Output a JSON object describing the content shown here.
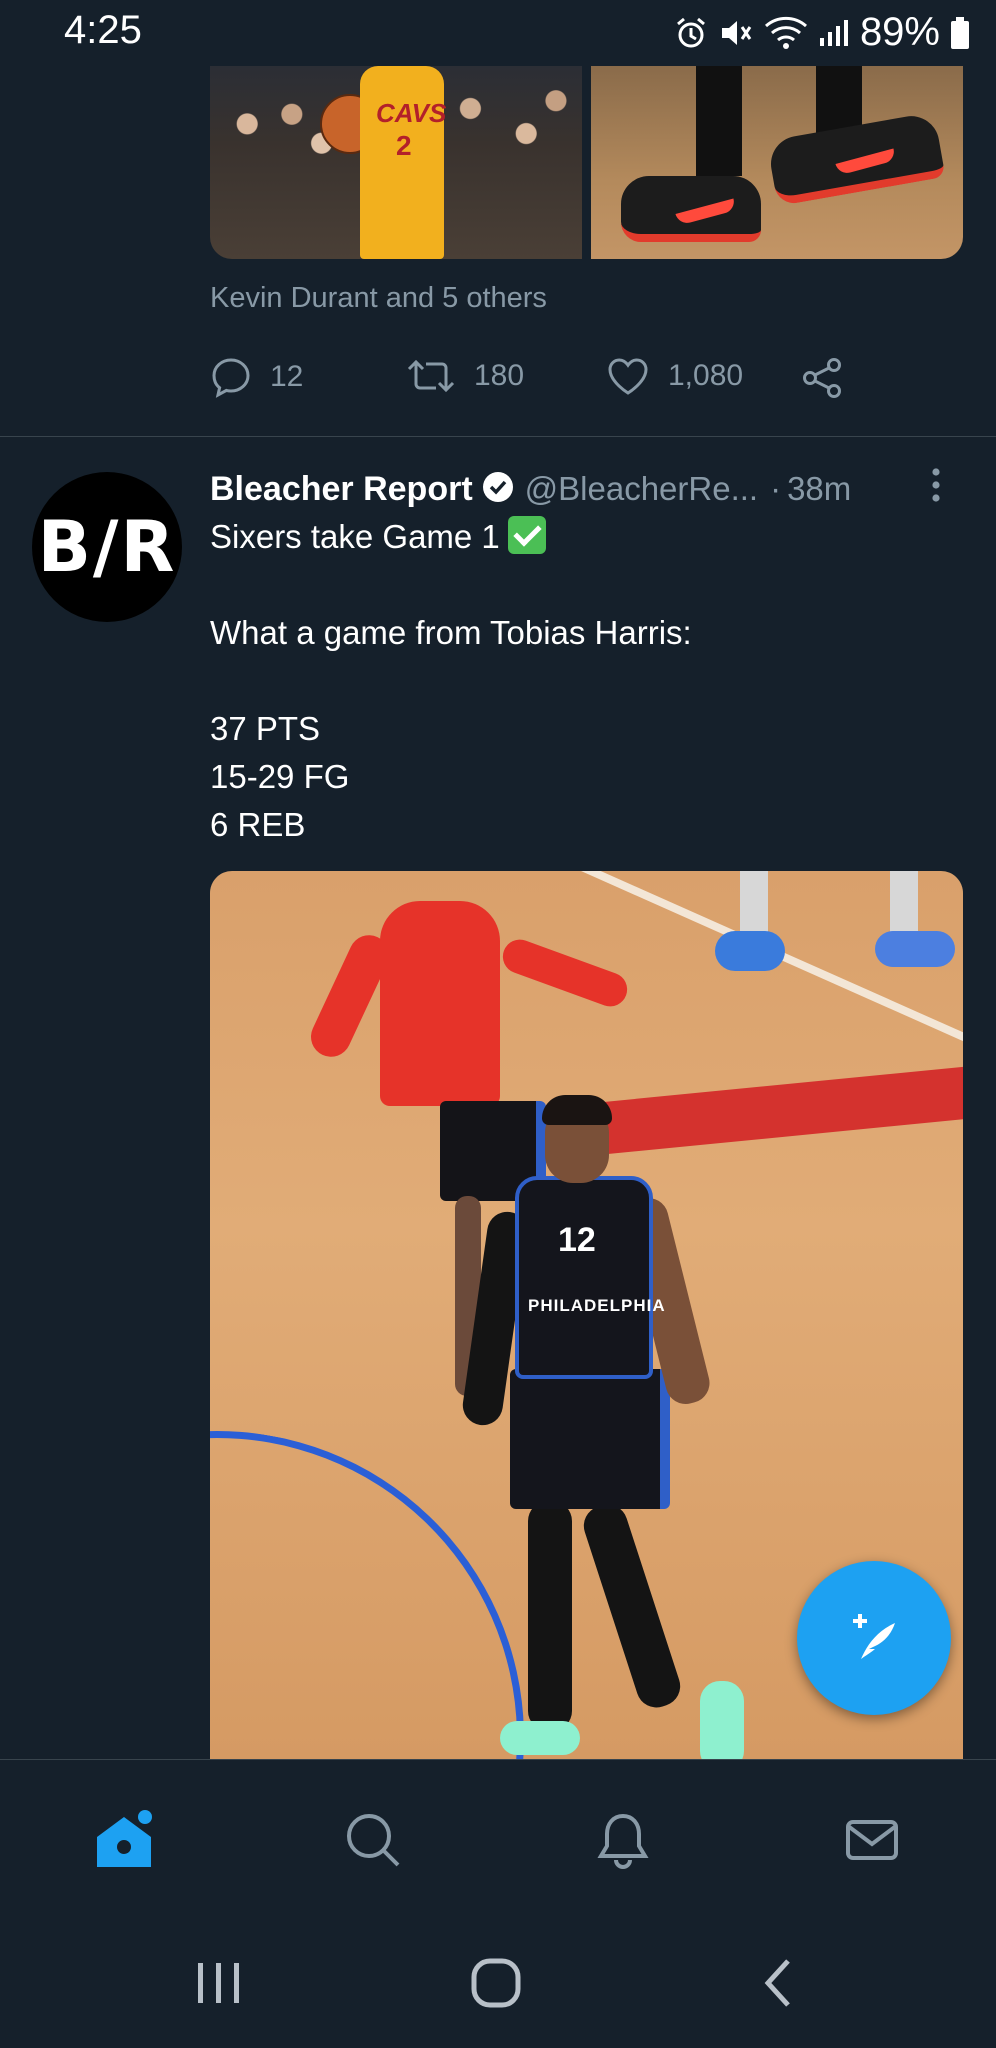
{
  "status_bar": {
    "time": "4:25",
    "battery": "89%"
  },
  "previous_tweet": {
    "media": {
      "left_jersey_team": "CAVS",
      "left_jersey_number": "2"
    },
    "liked_by": "Kevin Durant and 5 others",
    "actions": {
      "reply_count": "12",
      "retweet_count": "180",
      "like_count": "1,080"
    }
  },
  "tweet": {
    "avatar_text": "B/R",
    "author": "Bleacher Report",
    "handle": "@BleacherRe...",
    "dot": "·",
    "time": "38m",
    "lines": {
      "line1": "Sixers take Game 1",
      "line2": "What a game from Tobias Harris:",
      "line3": "37 PTS",
      "line4": "15-29 FG",
      "line5": "6 REB"
    },
    "image": {
      "jersey_number": "12",
      "jersey_text": "PHILADELPHIA"
    }
  },
  "colors": {
    "background": "#15202b",
    "accent": "#1da1f2",
    "secondary_text": "#8899a6",
    "divider": "#38444d"
  },
  "icons": {
    "status": [
      "alarm-icon",
      "mute-icon",
      "wifi-icon",
      "signal-icon",
      "battery-icon"
    ],
    "actions": [
      "reply-icon",
      "retweet-icon",
      "like-icon",
      "share-icon"
    ],
    "nav": [
      "home-icon",
      "search-icon",
      "notifications-icon",
      "messages-icon"
    ],
    "system": [
      "recent-apps-icon",
      "home-circle-icon",
      "back-icon"
    ],
    "fab": "compose-tweet-icon"
  }
}
